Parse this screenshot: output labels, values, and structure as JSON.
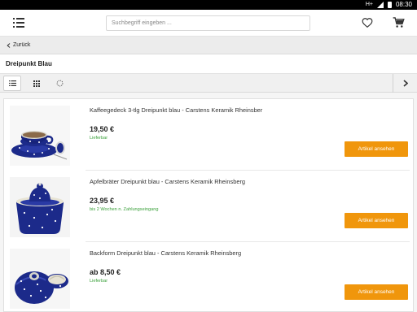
{
  "status_bar": {
    "network": "H+",
    "time": "08:30"
  },
  "header": {
    "search_placeholder": "Suchbegriff eingeben ...",
    "icons": [
      "menu-icon",
      "heart-icon",
      "cart-icon"
    ]
  },
  "nav": {
    "back_label": "Zurück"
  },
  "category": {
    "title": "Dreipunkt Blau"
  },
  "toolbar": {
    "icons": [
      "list-view-icon",
      "grid-view-icon",
      "loading-icon",
      "chevron-right-icon"
    ],
    "active_view": "list"
  },
  "products": [
    {
      "name": "Kaffeegedeck 3-tlg Dreipunkt blau - Carstens Keramik Rheinsber",
      "price": "19,50 €",
      "availability": "Lieferbar",
      "button": "Artikel ansehen"
    },
    {
      "name": "Apfelbräter Dreipunkt blau - Carstens Keramik Rheinsberg",
      "price": "23,95 €",
      "availability": "bis 2 Wochen n. Zahlungseingang",
      "button": "Artikel ansehen"
    },
    {
      "name": "Backform Dreipunkt blau - Carstens Keramik Rheinsberg",
      "price": "ab 8,50 €",
      "availability": "Lieferbar",
      "button": "Artikel ansehen"
    }
  ],
  "colors": {
    "accent": "#f0960c",
    "availability": "#3aa03a",
    "ceramic_blue": "#1c2a8a"
  }
}
